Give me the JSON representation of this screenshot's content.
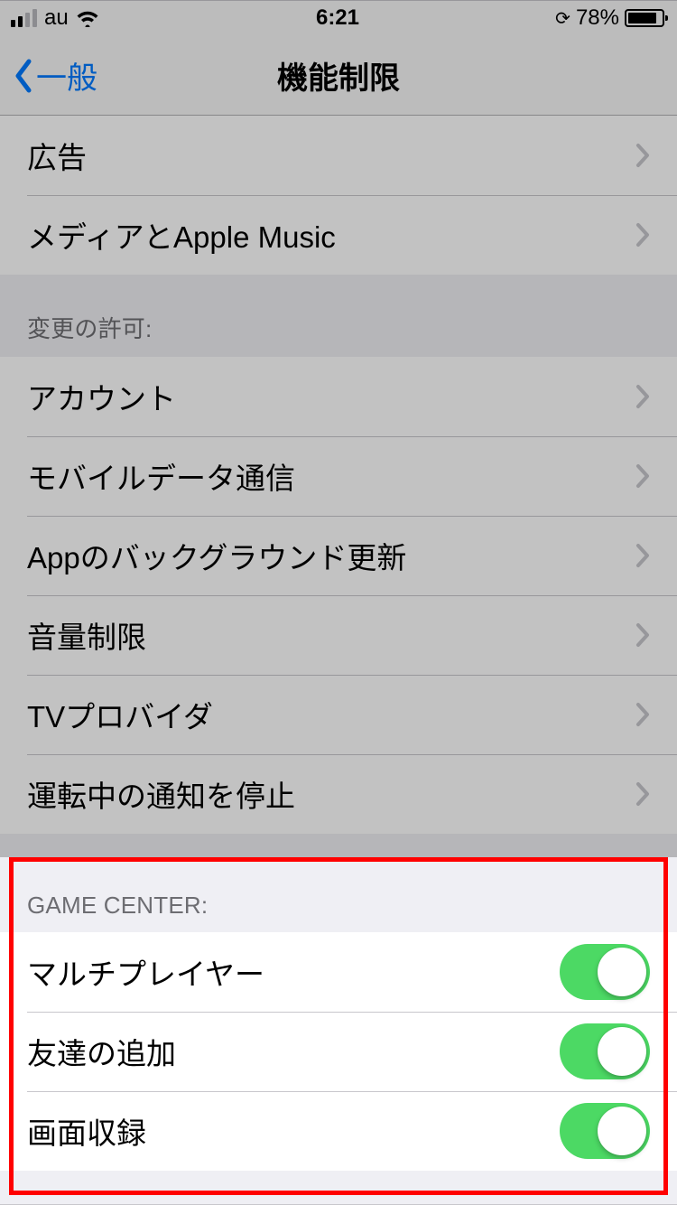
{
  "status_bar": {
    "carrier": "au",
    "time": "6:21",
    "battery_percent": "78%"
  },
  "nav": {
    "back_label": "一般",
    "title": "機能制限"
  },
  "section1_items": [
    {
      "label": "広告"
    },
    {
      "label": "メディアとApple Music"
    }
  ],
  "section2_header": "変更の許可:",
  "section2_items": [
    {
      "label": "アカウント"
    },
    {
      "label": "モバイルデータ通信"
    },
    {
      "label": "Appのバックグラウンド更新"
    },
    {
      "label": "音量制限"
    },
    {
      "label": "TVプロバイダ"
    },
    {
      "label": "運転中の通知を停止"
    }
  ],
  "section3_header": "GAME CENTER:",
  "section3_items": [
    {
      "label": "マルチプレイヤー",
      "enabled": true
    },
    {
      "label": "友達の追加",
      "enabled": true
    },
    {
      "label": "画面収録",
      "enabled": true
    }
  ]
}
